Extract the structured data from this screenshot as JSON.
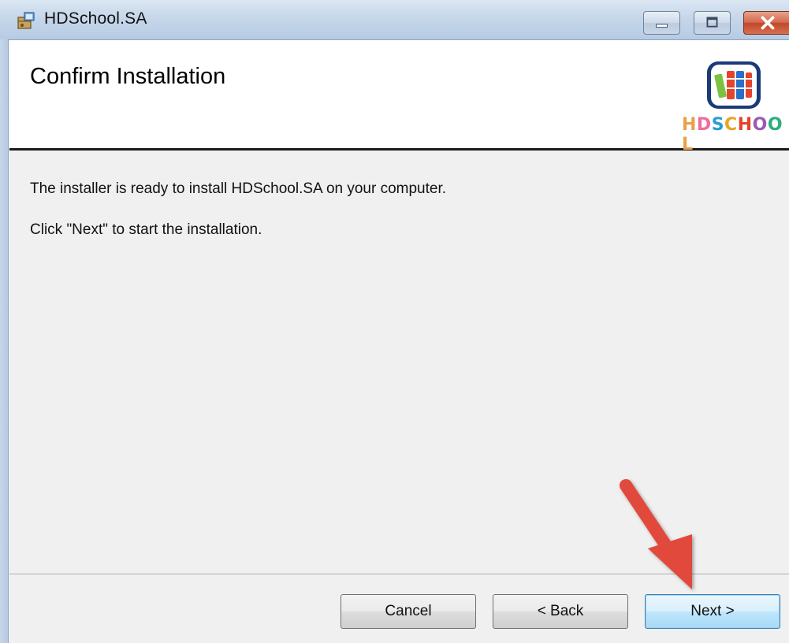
{
  "window": {
    "title": "HDSchool.SA"
  },
  "header": {
    "title": "Confirm Installation",
    "logo_letters": [
      "H",
      "D",
      "S",
      "C",
      "H",
      "O",
      "O",
      "L"
    ],
    "logo_colors": [
      "#e9a04a",
      "#f06b9a",
      "#2a9bd3",
      "#e6a61f",
      "#e4442b",
      "#9b59b6",
      "#2ab07b",
      "#e9a04a"
    ]
  },
  "body": {
    "line1": "The installer is ready to install HDSchool.SA on your computer.",
    "line2": "Click \"Next\" to start the installation."
  },
  "buttons": {
    "cancel": "Cancel",
    "back": "< Back",
    "next": "Next >"
  },
  "icons": {
    "app": "installer-icon",
    "minimize": "minimize-icon",
    "maximize": "maximize-icon",
    "close": "close-icon",
    "logo": "hdschool-logo",
    "annotation": "red-arrow-annotation"
  },
  "colors": {
    "arrow": "#e2483d",
    "close_button": "#c2472a"
  }
}
